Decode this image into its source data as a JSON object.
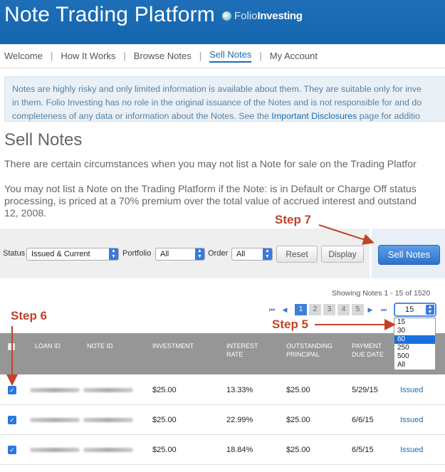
{
  "app": {
    "title": "Note Trading Platform",
    "brand_a": "Folio",
    "brand_b": "Investing"
  },
  "nav": {
    "items": [
      "Welcome",
      "How It Works",
      "Browse Notes",
      "Sell Notes",
      "My Account"
    ],
    "active": "Sell Notes"
  },
  "notice": {
    "line1": "Notes are highly risky and only limited information is available about them. They are suitable only for inve",
    "line2": "in them. Folio Investing has no role in the original issuance of the Notes and is not responsible for and do",
    "line3_pre": "completeness of any data or information about the Notes. See the ",
    "line3_link": "Important Disclosures",
    "line3_post": " page for additio"
  },
  "page": {
    "title": "Sell Notes",
    "para1": "There are certain circumstances when you may not list a Note for sale on the Trading Platfor",
    "para2_l1": "You may not list a Note on the Trading Platform if the Note: is in Default or Charge Off status",
    "para2_l2": "processing, is priced at a 70% premium over the total value of accrued interest and outstand",
    "para2_l3": "12, 2008."
  },
  "filters": {
    "status_label": "Status",
    "status_value": "Issued & Current",
    "portfolio_label": "Portfolio",
    "portfolio_value": "All",
    "order_label": "Order",
    "order_value": "All",
    "reset": "Reset",
    "display": "Display",
    "sell": "Sell Notes"
  },
  "pagination": {
    "showing": "Showing Notes 1 - 15 of 1520",
    "first": "⏮",
    "prev": "◀",
    "next": "▶",
    "last": "⏭",
    "pages": [
      "1",
      "2",
      "3",
      "4",
      "5"
    ],
    "active_page": "1",
    "per_page": "15",
    "per_page_options": [
      "15",
      "30",
      "60",
      "250",
      "500",
      "All"
    ],
    "highlighted_option": "60"
  },
  "table": {
    "headers": {
      "loan_id": "LOAN ID",
      "note_id": "NOTE ID",
      "investment": "INVESTMENT",
      "interest_1": "INTEREST",
      "interest_2": "RATE",
      "outstanding_1": "OUTSTANDING",
      "outstanding_2": "PRINCIPAL",
      "payment_1": "PAYMENT",
      "payment_2": "DUE DATE"
    },
    "rows": [
      {
        "investment": "$25.00",
        "rate": "13.33%",
        "principal": "$25.00",
        "due": "5/29/15",
        "status": "Issued"
      },
      {
        "investment": "$25.00",
        "rate": "22.99%",
        "principal": "$25.00",
        "due": "6/6/15",
        "status": "Issued"
      },
      {
        "investment": "$25.00",
        "rate": "18.84%",
        "principal": "$25.00",
        "due": "6/5/15",
        "status": "Issued"
      }
    ]
  },
  "annotations": {
    "step5": "Step 5",
    "step6": "Step 6",
    "step7": "Step 7"
  },
  "colors": {
    "header": "#1565ae",
    "accent": "#1c6cb0",
    "annotation": "#c2432a"
  }
}
